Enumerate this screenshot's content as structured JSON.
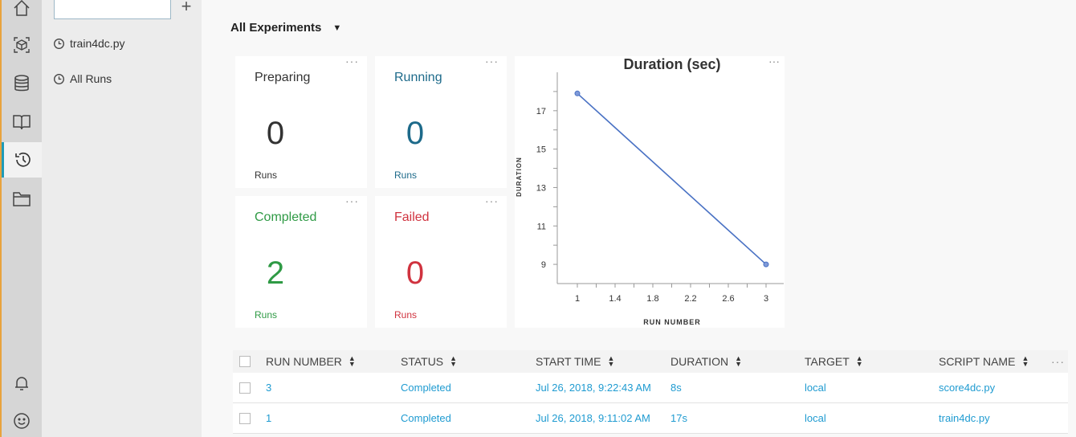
{
  "rail": {
    "items": [
      {
        "name": "home-icon",
        "active": false
      },
      {
        "name": "cube-icon",
        "active": false
      },
      {
        "name": "database-icon",
        "active": false
      },
      {
        "name": "book-icon",
        "active": false
      },
      {
        "name": "history-icon",
        "active": true
      },
      {
        "name": "folder-icon",
        "active": false
      }
    ],
    "bottom": [
      "bell-icon",
      "smiley-icon"
    ]
  },
  "explorer": {
    "input_value": "",
    "add_label": "+",
    "items": [
      {
        "label": "train4dc.py",
        "icon": "clock-icon"
      },
      {
        "label": "All Runs",
        "icon": "clock-icon"
      }
    ]
  },
  "main": {
    "scope_label": "All Experiments",
    "cards": {
      "preparing": {
        "title": "Preparing",
        "count": "0",
        "unit": "Runs",
        "title_color": "#333333",
        "count_color": "#333333",
        "unit_color": "#333333"
      },
      "running": {
        "title": "Running",
        "count": "0",
        "unit": "Runs",
        "title_color": "#1d6a8a",
        "count_color": "#1d6a8a",
        "unit_color": "#1d6a8a"
      },
      "completed": {
        "title": "Completed",
        "count": "2",
        "unit": "Runs",
        "title_color": "#2f9a45",
        "count_color": "#2f9a45",
        "unit_color": "#2f9a45"
      },
      "failed": {
        "title": "Failed",
        "count": "0",
        "unit": "Runs",
        "title_color": "#d0333f",
        "count_color": "#d0333f",
        "unit_color": "#d0333f"
      }
    },
    "more_label": "···"
  },
  "chart_data": {
    "type": "line",
    "title": "Duration (sec)",
    "xlabel": "RUN NUMBER",
    "ylabel": "DURATION",
    "x": [
      1,
      3
    ],
    "series": [
      {
        "values": [
          17.9,
          9.0
        ],
        "color": "#4a72c4"
      }
    ],
    "xticks": [
      "1",
      "1.4",
      "1.8",
      "2.2",
      "2.6",
      "3"
    ],
    "yticks": [
      "9",
      "11",
      "13",
      "15",
      "17"
    ],
    "xlim": [
      1,
      3
    ],
    "ylim": [
      8,
      19
    ]
  },
  "table": {
    "headers": {
      "run_number": "RUN NUMBER",
      "status": "STATUS",
      "start_time": "START TIME",
      "duration": "DURATION",
      "target": "TARGET",
      "script_name": "SCRIPT NAME"
    },
    "more_label": "···",
    "rows": [
      {
        "run_number": "3",
        "status": "Completed",
        "start_time": "Jul 26, 2018, 9:22:43 AM",
        "duration": "8s",
        "target": "local",
        "script_name": "score4dc.py"
      },
      {
        "run_number": "1",
        "status": "Completed",
        "start_time": "Jul 26, 2018, 9:11:02 AM",
        "duration": "17s",
        "target": "local",
        "script_name": "train4dc.py"
      }
    ]
  },
  "colors": {
    "accent": "#1f9bd1",
    "rail_accent": "#1f9bb8"
  }
}
